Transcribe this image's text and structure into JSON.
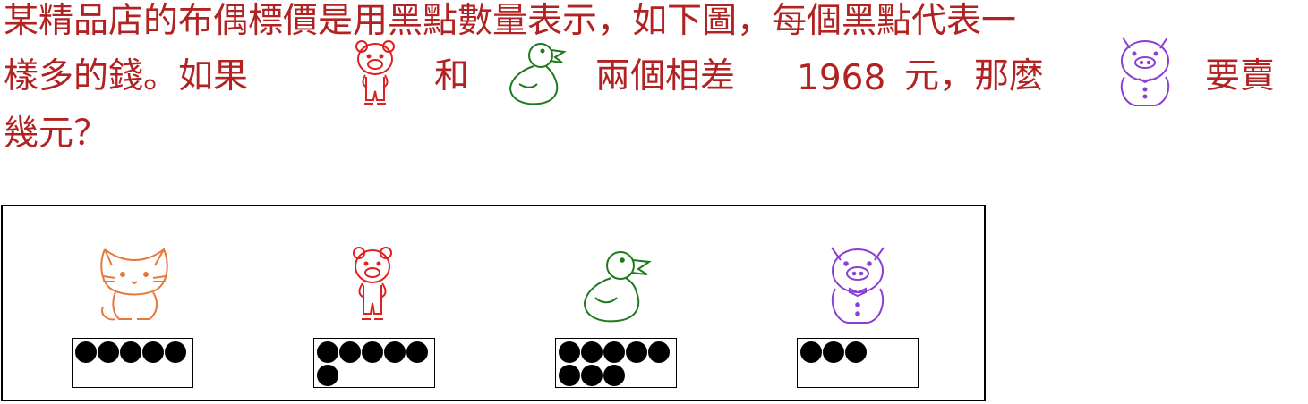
{
  "question": {
    "line1": "某精品店的布偶標價是用黑點數量表示，如下圖，每個黑點代表一",
    "line2_a": "樣多的錢。如果",
    "line2_b": "和",
    "line2_c": "兩個相差",
    "line2_num": "1968",
    "line2_d": "元，那麼",
    "line2_e": "要賣",
    "line3": "幾元？",
    "text_color": "#b22222"
  },
  "toys": [
    {
      "name": "cat",
      "icon": "cat-icon",
      "color": "#e8773a",
      "dots": 5
    },
    {
      "name": "bear",
      "icon": "bear-icon",
      "color": "#e02020",
      "dots": 6
    },
    {
      "name": "duck",
      "icon": "duck-icon",
      "color": "#1e7a1e",
      "dots": 8
    },
    {
      "name": "pig",
      "icon": "pig-icon",
      "color": "#8a3fd6",
      "dots": 3
    }
  ]
}
